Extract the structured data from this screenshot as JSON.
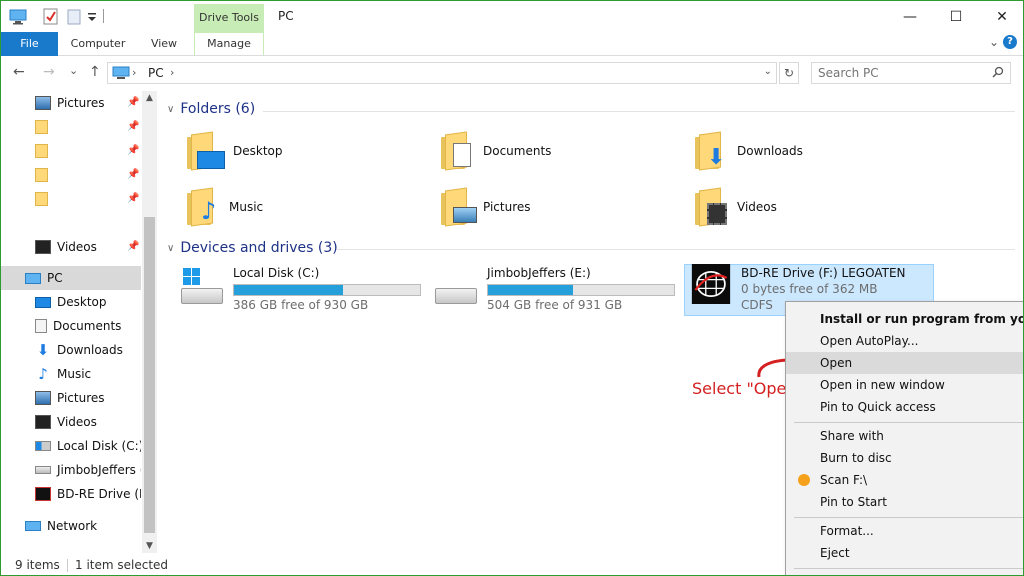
{
  "window": {
    "title": "PC",
    "context_tab_header": "Drive Tools",
    "minimize": "—",
    "maximize": "☐",
    "close": "✕"
  },
  "ribbon": {
    "tabs": [
      "File",
      "Computer",
      "View",
      "Manage"
    ],
    "expand_icon": "⌄",
    "help": "?"
  },
  "address": {
    "back": "←",
    "forward": "→",
    "recent": "⌄",
    "up": "↑",
    "path": "PC",
    "chevron": "›",
    "dropdown": "⌄",
    "refresh": "↻",
    "search_placeholder": "Search PC"
  },
  "nav": {
    "items": [
      {
        "label": "Pictures",
        "icon": "pictures-icon",
        "pinned": true
      },
      {
        "label": "",
        "icon": "folder-icon",
        "pinned": true
      },
      {
        "label": "",
        "icon": "folder-icon",
        "pinned": true
      },
      {
        "label": "",
        "icon": "folder-icon",
        "pinned": true
      },
      {
        "label": "",
        "icon": "folder-icon",
        "pinned": true
      },
      {
        "label": "Videos",
        "icon": "videos-icon",
        "pinned": true
      },
      {
        "label": "PC",
        "icon": "pc-icon",
        "pinned": false,
        "selected": true
      },
      {
        "label": "Desktop",
        "icon": "desktop-icon"
      },
      {
        "label": "Documents",
        "icon": "documents-icon"
      },
      {
        "label": "Downloads",
        "icon": "downloads-icon"
      },
      {
        "label": "Music",
        "icon": "music-icon"
      },
      {
        "label": "Pictures",
        "icon": "pictures-icon"
      },
      {
        "label": "Videos",
        "icon": "videos-icon"
      },
      {
        "label": "Local Disk (C:)",
        "icon": "drive-icon"
      },
      {
        "label": "JimbobJeffers (E:)",
        "icon": "drive-icon"
      },
      {
        "label": "BD-RE Drive (F:)",
        "icon": "bd-drive-icon"
      },
      {
        "label": "Network",
        "icon": "network-icon"
      }
    ]
  },
  "content": {
    "folders_header": "Folders (6)",
    "folders": [
      "Desktop",
      "Documents",
      "Downloads",
      "Music",
      "Pictures",
      "Videos"
    ],
    "devices_header": "Devices and drives (3)",
    "drives": [
      {
        "name": "Local Disk (C:)",
        "free": "386 GB free of 930 GB",
        "used_fraction": 0.585
      },
      {
        "name": "JimbobJeffers (E:)",
        "free": "504 GB free of 931 GB",
        "used_fraction": 0.459
      },
      {
        "name": "BD-RE Drive (F:) LEGOATEN",
        "free": "0 bytes free of 362 MB",
        "fs": "CDFS",
        "selected": true
      }
    ]
  },
  "context_menu": {
    "items": [
      "Install or run program from your media",
      "Open AutoPlay...",
      "Open",
      "Open in new window",
      "Pin to Quick access",
      "Share with",
      "Burn to disc",
      "Scan F:\\",
      "Pin to Start",
      "Format...",
      "Eject"
    ],
    "highlighted": "Open"
  },
  "annotation": "Select \"Open\"",
  "status": {
    "items": "9 items",
    "selected": "1 item selected"
  },
  "colors": {
    "accent": "#1979ca",
    "drive_tools": "#c8ecb5",
    "progress": "#26a0da",
    "selection": "#cce8ff",
    "annotation": "#d42020",
    "window_border": "#2d9b2d"
  }
}
